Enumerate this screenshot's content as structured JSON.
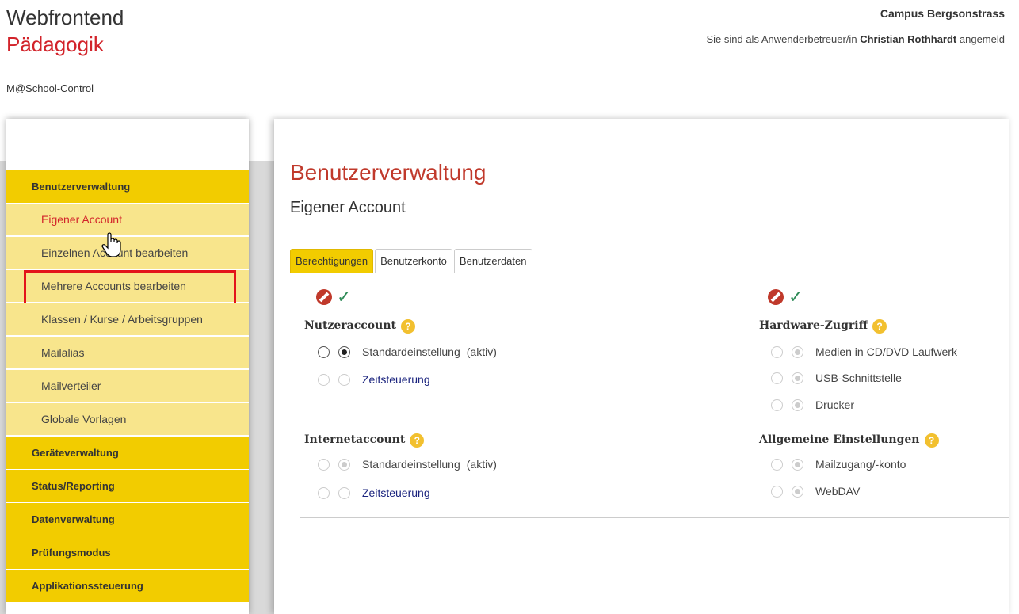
{
  "header": {
    "title": "Webfrontend",
    "subtitle": "Pädagogik",
    "product": "M@School-Control",
    "campus": "Campus Bergsonstrass",
    "login_prefix": "Sie sind als",
    "role": "Anwenderbetreuer/in",
    "user_first": "Christian",
    "user_last": "Rothhardt",
    "login_suffix": "angemeld"
  },
  "sidebar": {
    "groups": [
      {
        "label": "Benutzerverwaltung"
      },
      {
        "label": "Geräteverwaltung"
      },
      {
        "label": "Status/Reporting"
      },
      {
        "label": "Datenverwaltung"
      },
      {
        "label": "Prüfungsmodus"
      },
      {
        "label": "Applikationssteuerung"
      }
    ],
    "items": [
      {
        "label": "Eigener Account"
      },
      {
        "label": "Einzelnen Account bearbeiten"
      },
      {
        "label": "Mehrere Accounts bearbeiten"
      },
      {
        "label": "Klassen / Kurse / Arbeitsgruppen"
      },
      {
        "label": "Mailalias"
      },
      {
        "label": "Mailverteiler"
      },
      {
        "label": "Globale Vorlagen"
      }
    ]
  },
  "main": {
    "title": "Benutzerverwaltung",
    "subtitle": "Eigener Account",
    "tabs": [
      {
        "label": "Berechtigungen"
      },
      {
        "label": "Benutzerkonto"
      },
      {
        "label": "Benutzerdaten"
      }
    ],
    "help_symbol": "?",
    "sections": {
      "nutzeraccount": {
        "title": "Nutzeraccount",
        "options": [
          {
            "label": "Standardeinstellung",
            "status": "(aktiv)"
          },
          {
            "label": "Zeitsteuerung"
          }
        ]
      },
      "internetaccount": {
        "title": "Internetaccount",
        "options": [
          {
            "label": "Standardeinstellung",
            "status": "(aktiv)"
          },
          {
            "label": "Zeitsteuerung"
          }
        ]
      },
      "hardware": {
        "title": "Hardware-Zugriff",
        "options": [
          {
            "label": "Medien in CD/DVD Laufwerk"
          },
          {
            "label": "USB-Schnittstelle"
          },
          {
            "label": "Drucker"
          }
        ]
      },
      "allgemein": {
        "title": "Allgemeine Einstellungen",
        "options": [
          {
            "label": "Mailzugang/-konto"
          },
          {
            "label": "WebDAV"
          }
        ]
      }
    }
  },
  "colors": {
    "accent_yellow": "#f2cc00",
    "item_yellow": "#f8e58c",
    "brand_red": "#d2232a",
    "highlight_box": "#e3141b",
    "check_green": "#2e8b57"
  },
  "icons": [
    "hand-cursor-icon",
    "deny-icon",
    "allow-check-icon",
    "help-icon"
  ]
}
